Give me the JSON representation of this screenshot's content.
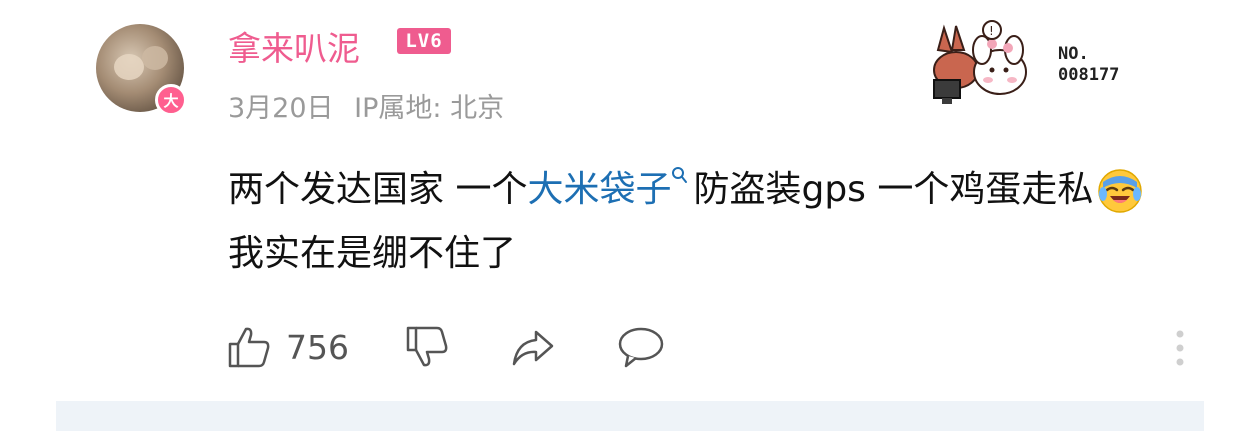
{
  "comment": {
    "author": {
      "name": "拿来叭泥",
      "level": "LV6",
      "avatar_badge": "大"
    },
    "meta": {
      "date": "3月20日",
      "ip_location": "IP属地: 北京"
    },
    "decoration": {
      "number_label": "NO.\n008177",
      "sticker_icon": "bunny-sticker-icon"
    },
    "text": {
      "part1": "两个发达国家 一个",
      "link": "大米袋子",
      "part2": "防盗装gps 一个鸡蛋走私",
      "part3": "我实在是绷不住了",
      "emoji": "laughing-crying-emoji"
    },
    "actions": {
      "like_count": "756",
      "like_icon": "thumbs-up-icon",
      "dislike_icon": "thumbs-down-icon",
      "share_icon": "share-icon",
      "reply_icon": "comment-icon",
      "more_icon": "more-vertical-icon"
    }
  },
  "colors": {
    "username": "#ef5c8f",
    "link": "#1d6fb3",
    "meta": "#9a9a9a",
    "icons": "#555555",
    "bottom_bar": "#eef3f8"
  }
}
